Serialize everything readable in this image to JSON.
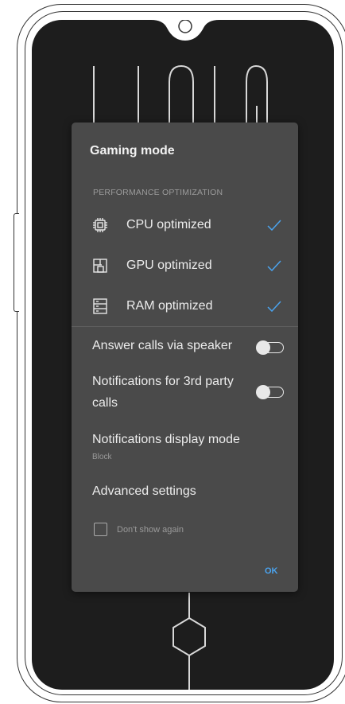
{
  "dialog": {
    "title": "Gaming mode",
    "section_label": "PERFORMANCE OPTIMIZATION",
    "performance_items": [
      {
        "icon": "cpu-chip-icon",
        "label": "CPU  optimized",
        "checked": true
      },
      {
        "icon": "gpu-board-icon",
        "label": "GPU  optimized",
        "checked": true
      },
      {
        "icon": "ram-memory-icon",
        "label": "RAM  optimized",
        "checked": true
      }
    ],
    "settings": {
      "answer_calls_label": "Answer calls via speaker",
      "answer_calls_on": false,
      "notifications_3rd_party_label_line1": "Notifications for 3rd party",
      "notifications_3rd_party_label_line2": "calls",
      "notifications_3rd_party_on": false,
      "display_mode_label": "Notifications display mode",
      "display_mode_value": "Block",
      "advanced_label": "Advanced settings"
    },
    "dont_show_label": "Don't show again",
    "dont_show_checked": false,
    "ok_label": "OK"
  },
  "colors": {
    "accent": "#4aa3ee",
    "dialog_bg": "#4a4a4a",
    "screen_bg": "#1d1d1d"
  }
}
